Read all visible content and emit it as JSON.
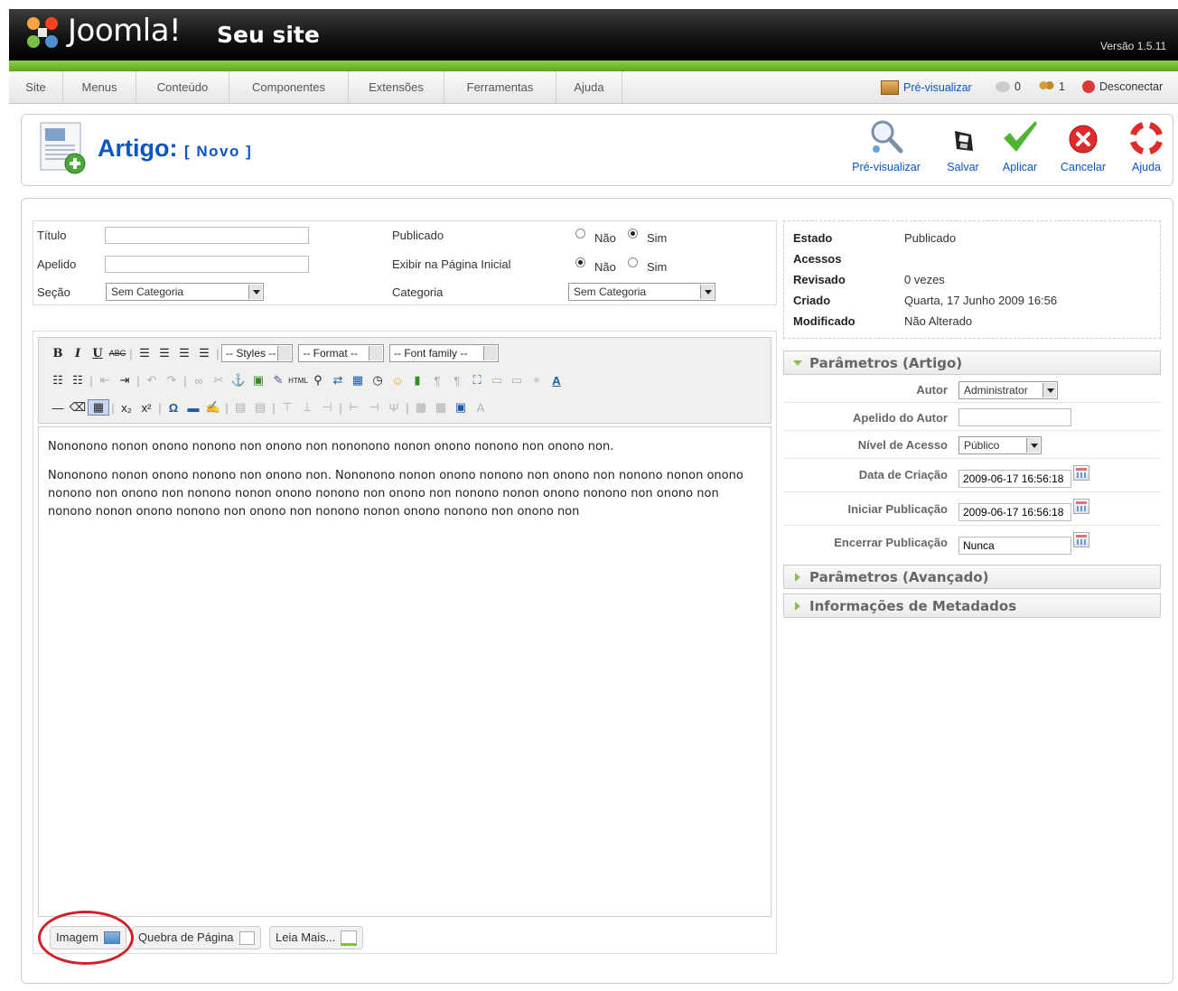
{
  "header": {
    "logo_text": "Joomla!",
    "site_name": "Seu site",
    "version": "Versão 1.5.11"
  },
  "menu": {
    "items": [
      "Site",
      "Menus",
      "Conteúdo",
      "Componentes",
      "Extensões",
      "Ferramentas",
      "Ajuda"
    ]
  },
  "status_bar": {
    "preview": "Pré-visualizar",
    "messages_count": "0",
    "users_count": "1",
    "logout": "Desconectar"
  },
  "toolbar": {
    "title": "Artigo:",
    "subtitle": "[ Novo ]",
    "buttons": {
      "preview": "Pré-visualizar",
      "save": "Salvar",
      "apply": "Aplicar",
      "cancel": "Cancelar",
      "help": "Ajuda"
    }
  },
  "details": {
    "title_label": "Título",
    "title_value": "",
    "alias_label": "Apelido",
    "alias_value": "",
    "section_label": "Seção",
    "section_value": "Sem Categoria",
    "published_label": "Publicado",
    "frontpage_label": "Exibir na Página Inicial",
    "category_label": "Categoria",
    "category_value": "Sem Categoria",
    "no": "Não",
    "yes": "Sim",
    "published_selected": "Sim",
    "frontpage_selected": "Não"
  },
  "editor": {
    "styles": "-- Styles --",
    "format": "-- Format --",
    "font_family": "-- Font family --",
    "paragraph1": "Nononono nonon onono nonono non onono non nononono nonon onono nonono non onono non.",
    "paragraph2": "Nononono nonon onono nonono non onono non. Nononono nonon onono nonono non onono non nonono nonon onono nonono non onono non nonono nonon onono nonono non onono non nonono nonon onono nonono non onono non nonono nonon onono nonono non onono non nonono nonon onono nonono non onono non",
    "buttons": {
      "image": "Imagem",
      "page_break": "Quebra de Página",
      "read_more": "Leia Mais..."
    }
  },
  "status_info": {
    "state_label": "Estado",
    "state_value": "Publicado",
    "hits_label": "Acessos",
    "hits_value": "",
    "revised_label": "Revisado",
    "revised_value": "0 vezes",
    "created_label": "Criado",
    "created_value": "Quarta, 17 Junho 2009 16:56",
    "modified_label": "Modificado",
    "modified_value": "Não Alterado"
  },
  "params": {
    "article_title": "Parâmetros (Artigo)",
    "author_label": "Autor",
    "author_value": "Administrator",
    "author_alias_label": "Apelido do Autor",
    "author_alias_value": "",
    "access_label": "Nível de Acesso",
    "access_value": "Público",
    "created_date_label": "Data de Criação",
    "created_date_value": "2009-06-17 16:56:18",
    "publish_up_label": "Iniciar Publicação",
    "publish_up_value": "2009-06-17 16:56:18",
    "publish_down_label": "Encerrar Publicação",
    "publish_down_value": "Nunca",
    "advanced_title": "Parâmetros (Avançado)",
    "metadata_title": "Informações de Metadados"
  },
  "colors": {
    "accent": "#0b55c4",
    "header_bg": "#141414",
    "green_bar": "#6db33f",
    "highlight_circle": "#d0202a"
  }
}
